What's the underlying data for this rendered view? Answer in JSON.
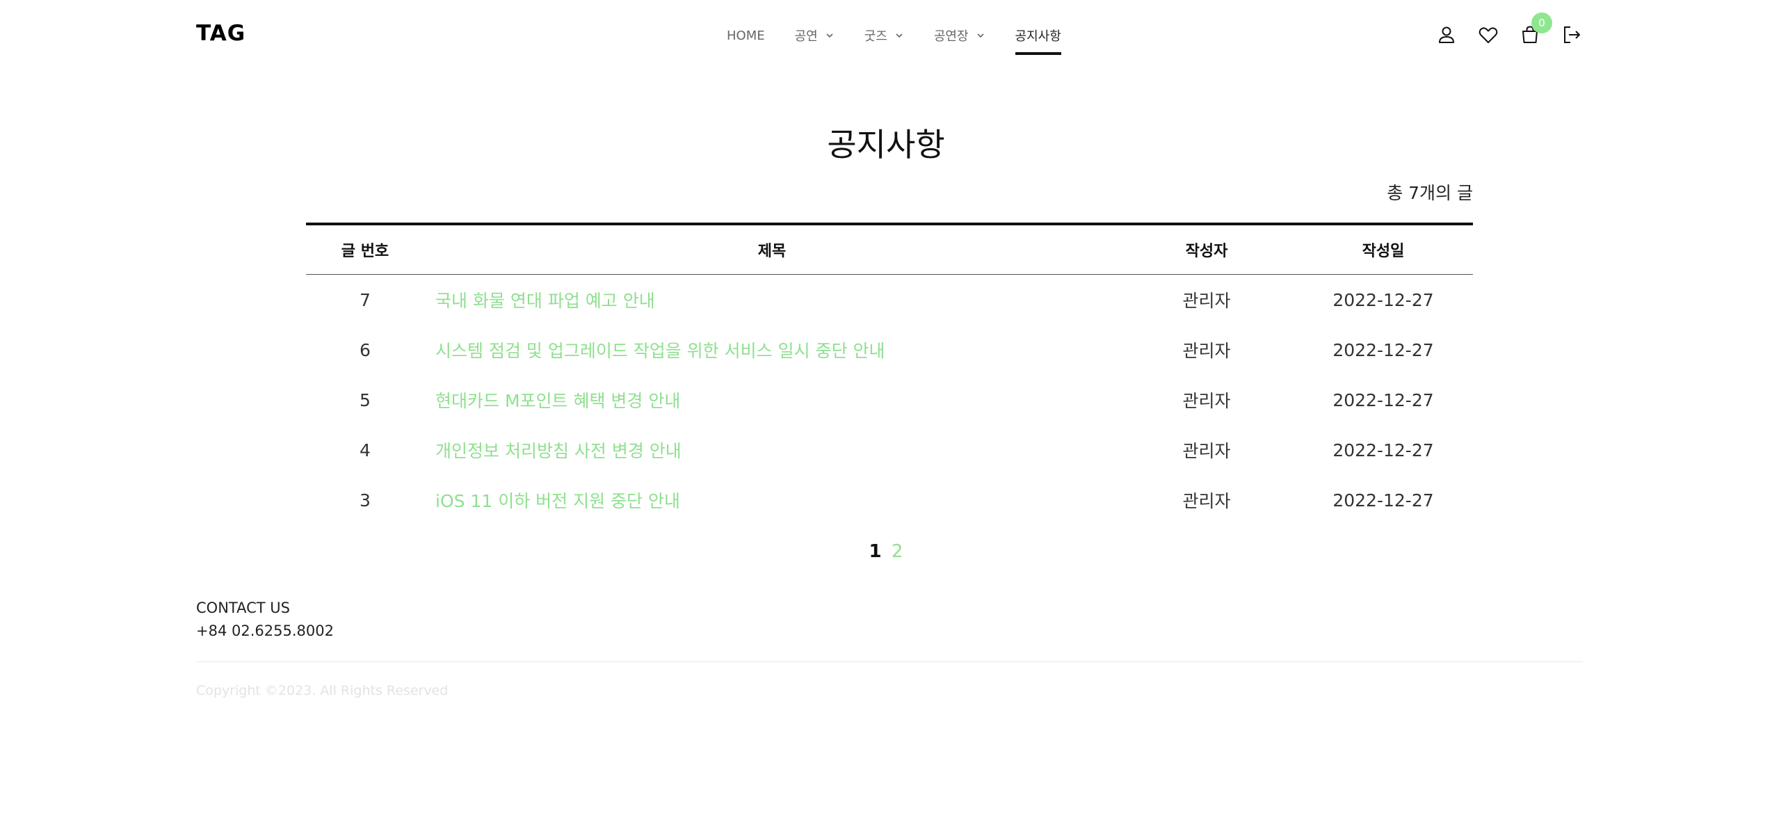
{
  "brand": {
    "logo": "TAG"
  },
  "nav": {
    "items": [
      {
        "label": "HOME",
        "dropdown": false
      },
      {
        "label": "공연",
        "dropdown": true
      },
      {
        "label": "굿즈",
        "dropdown": true
      },
      {
        "label": "공연장",
        "dropdown": true
      },
      {
        "label": "공지사항",
        "dropdown": false,
        "active": true
      }
    ]
  },
  "header_icons": {
    "account": "user-icon",
    "wishlist": "heart-icon",
    "cart": "shopping-bag-icon",
    "cart_count": "0",
    "logout": "logout-icon"
  },
  "page": {
    "title": "공지사항",
    "total": "총 7개의 글"
  },
  "table": {
    "headers": {
      "number": "글 번호",
      "title": "제목",
      "author": "작성자",
      "date": "작성일"
    },
    "rows": [
      {
        "number": "7",
        "title": "국내 화물 연대 파업 예고 안내",
        "author": "관리자",
        "date": "2022-12-27"
      },
      {
        "number": "6",
        "title": "시스템 점검 및 업그레이드 작업을 위한 서비스 일시 중단 안내",
        "author": "관리자",
        "date": "2022-12-27"
      },
      {
        "number": "5",
        "title": "현대카드 M포인트 혜택 변경 안내",
        "author": "관리자",
        "date": "2022-12-27"
      },
      {
        "number": "4",
        "title": "개인정보 처리방침 사전 변경 안내",
        "author": "관리자",
        "date": "2022-12-27"
      },
      {
        "number": "3",
        "title": "iOS 11 이하 버전 지원 중단 안내",
        "author": "관리자",
        "date": "2022-12-27"
      }
    ]
  },
  "pagination": {
    "current": "1",
    "next": "2"
  },
  "footer": {
    "contact_title": "CONTACT US",
    "phone": "+84 02.6255.8002",
    "copyright": "Copyright ©2023. All Rights Reserved"
  },
  "colors": {
    "accent": "#8fe08f",
    "badge": "#8ee68e",
    "text": "#222222"
  }
}
